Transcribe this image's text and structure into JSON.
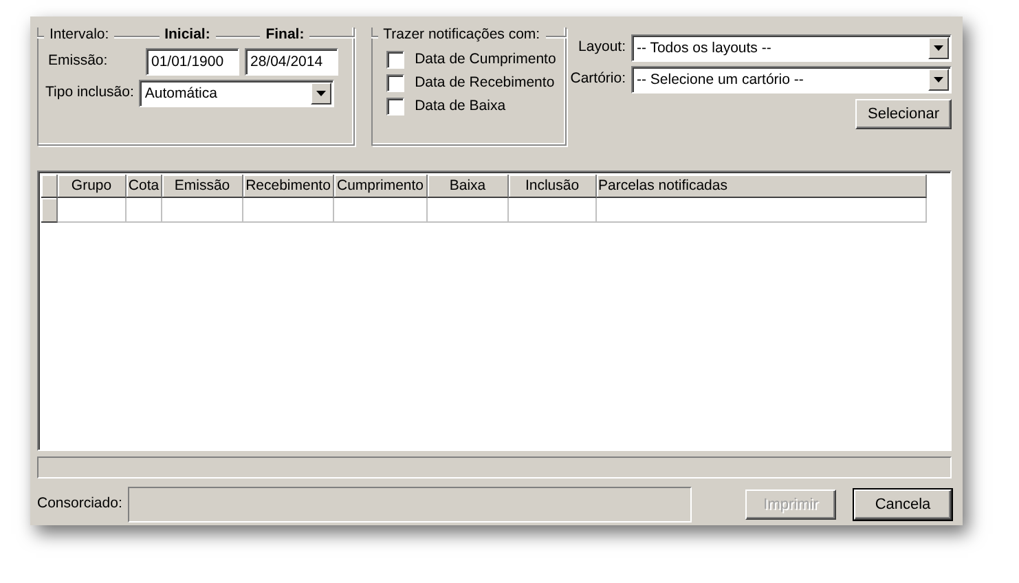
{
  "interval_group": {
    "label": "Intervalo:",
    "initial_label": "Inicial:",
    "final_label": "Final:",
    "emission_label": "Emissão:",
    "emission_start": "01/01/1900",
    "emission_end": "28/04/2014",
    "inclusion_type_label": "Tipo inclusão:",
    "inclusion_type": "Automática"
  },
  "notifications_group": {
    "title": "Trazer notificações com:",
    "options": [
      {
        "label": "Data de Cumprimento",
        "checked": false
      },
      {
        "label": "Data de Recebimento",
        "checked": false
      },
      {
        "label": "Data de Baixa",
        "checked": false
      }
    ]
  },
  "layout": {
    "label": "Layout:",
    "value": "-- Todos os layouts --"
  },
  "registry": {
    "label": "Cartório:",
    "value": "-- Selecione um cartório --"
  },
  "select_button": "Selecionar",
  "grid": {
    "columns": [
      "Grupo",
      "Cota",
      "Emissão",
      "Recebimento",
      "Cumprimento",
      "Baixa",
      "Inclusão",
      "Parcelas notificadas"
    ]
  },
  "consorciado": {
    "label": "Consorciado:"
  },
  "buttons": [
    {
      "label": "Imprimir",
      "disabled": true,
      "default": false
    },
    {
      "label": "Cancela",
      "disabled": false,
      "default": true
    }
  ]
}
